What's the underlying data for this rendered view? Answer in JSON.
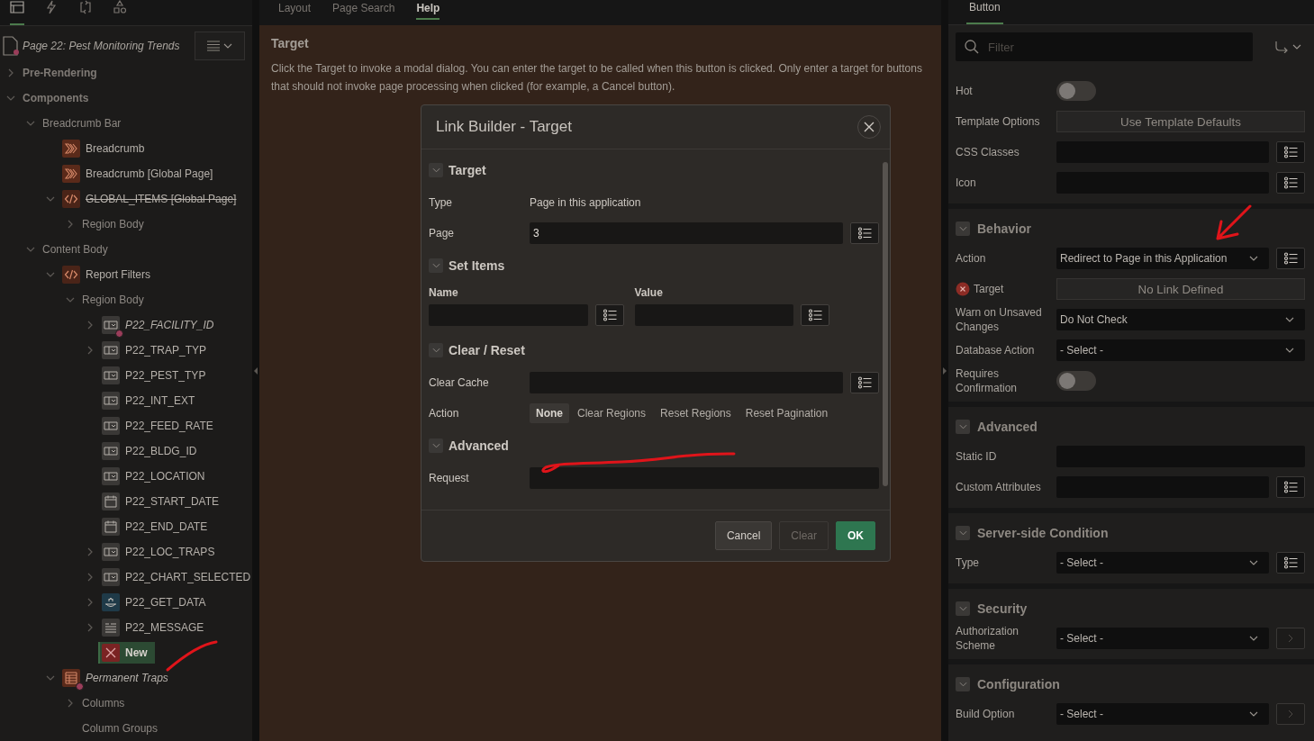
{
  "left_toolbar": {
    "tabs": [
      {
        "kind": "tree",
        "selected": true
      },
      {
        "kind": "bolt",
        "selected": false
      },
      {
        "kind": "loop",
        "selected": false
      },
      {
        "kind": "shapes",
        "selected": false
      }
    ]
  },
  "tree": {
    "page_title": "Page 22: Pest Monitoring Trends",
    "nodes": [
      {
        "label": "Pre-Rendering",
        "kind": "section",
        "expanded": false,
        "selected": false
      },
      {
        "label": "Components",
        "kind": "section",
        "expanded": true,
        "selected": false,
        "children": [
          {
            "label": "Breadcrumb Bar",
            "kind": "plain",
            "expanded": true,
            "selected": false,
            "children": [
              {
                "label": "Breadcrumb",
                "kind": "breadcrumb",
                "selected": false
              },
              {
                "label": "Breadcrumb [Global Page]",
                "kind": "breadcrumb",
                "selected": false
              },
              {
                "label": "GLOBAL_ITEMS [Global Page]",
                "kind": "code",
                "struck": true,
                "expanded": true,
                "selected": false,
                "children": [
                  {
                    "label": "Region Body",
                    "kind": "plain",
                    "expanded": false,
                    "selected": false
                  }
                ]
              }
            ]
          },
          {
            "label": "Content Body",
            "kind": "plain",
            "expanded": true,
            "selected": false,
            "children": [
              {
                "label": "Report Filters",
                "kind": "code",
                "expanded": true,
                "selected": false,
                "children": [
                  {
                    "label": "Region Body",
                    "kind": "plain",
                    "expanded": true,
                    "selected": false,
                    "children": [
                      {
                        "label": "P22_FACILITY_ID",
                        "kind": "select",
                        "italic": true,
                        "badge": true,
                        "expanded": false,
                        "selected": false
                      },
                      {
                        "label": "P22_TRAP_TYP",
                        "kind": "select",
                        "expanded": false,
                        "selected": false
                      },
                      {
                        "label": "P22_PEST_TYP",
                        "kind": "select",
                        "selected": false
                      },
                      {
                        "label": "P22_INT_EXT",
                        "kind": "select",
                        "selected": false
                      },
                      {
                        "label": "P22_FEED_RATE",
                        "kind": "select",
                        "selected": false
                      },
                      {
                        "label": "P22_BLDG_ID",
                        "kind": "select",
                        "selected": false
                      },
                      {
                        "label": "P22_LOCATION",
                        "kind": "select",
                        "selected": false
                      },
                      {
                        "label": "P22_START_DATE",
                        "kind": "date",
                        "selected": false
                      },
                      {
                        "label": "P22_END_DATE",
                        "kind": "date",
                        "selected": false
                      },
                      {
                        "label": "P22_LOC_TRAPS",
                        "kind": "select",
                        "expanded": false,
                        "selected": false
                      },
                      {
                        "label": "P22_CHART_SELECTED",
                        "kind": "select",
                        "expanded": false,
                        "selected": false
                      },
                      {
                        "label": "P22_GET_DATA",
                        "kind": "process",
                        "expanded": false,
                        "selected": false
                      },
                      {
                        "label": "P22_MESSAGE",
                        "kind": "display",
                        "expanded": false,
                        "selected": false
                      },
                      {
                        "label": "New",
                        "kind": "button-error",
                        "selected": true
                      }
                    ]
                  }
                ]
              },
              {
                "label": "Permanent Traps",
                "kind": "report",
                "italic": true,
                "badge": true,
                "expanded": true,
                "selected": false,
                "children": [
                  {
                    "label": "Columns",
                    "kind": "plain",
                    "expanded": false,
                    "selected": false
                  },
                  {
                    "label": "Column Groups",
                    "kind": "plain",
                    "selected": false
                  }
                ]
              }
            ]
          }
        ]
      }
    ]
  },
  "center": {
    "tabs": [
      {
        "label": "Layout",
        "selected": false
      },
      {
        "label": "Page Search",
        "selected": false
      },
      {
        "label": "Help",
        "selected": true
      }
    ],
    "help": {
      "title": "Target",
      "text": "Click the Target to invoke a modal dialog. You can enter the target to be called when this button is clicked. Only enter a target for buttons that should not invoke page processing when clicked (for example, a Cancel button)."
    }
  },
  "properties": {
    "tabs": [
      {
        "label": "Button",
        "selected": true
      }
    ],
    "filter": {
      "placeholder": "Filter"
    },
    "groups": [
      {
        "properties": [
          {
            "label": "Hot",
            "kind": "toggle",
            "on": false
          },
          {
            "label": "Template Options",
            "kind": "button",
            "value": "Use Template Defaults"
          },
          {
            "label": "CSS Classes",
            "kind": "text",
            "list_button": true
          },
          {
            "label": "Icon",
            "kind": "text",
            "list_button": true
          }
        ]
      },
      {
        "title": "Behavior",
        "properties": [
          {
            "label": "Action",
            "kind": "select",
            "value": "Redirect to Page in this Application",
            "list_button": true
          },
          {
            "label": "Target",
            "kind": "button",
            "value": "No Link Defined",
            "error": true
          },
          {
            "label": "Warn on Unsaved Changes",
            "kind": "select",
            "value": "Do Not Check"
          },
          {
            "label": "Database Action",
            "kind": "select",
            "value": "- Select -"
          },
          {
            "label": "Requires Confirmation",
            "kind": "toggle",
            "on": false
          }
        ]
      },
      {
        "title": "Advanced",
        "properties": [
          {
            "label": "Static ID",
            "kind": "text"
          },
          {
            "label": "Custom Attributes",
            "kind": "text",
            "list_button": true
          }
        ]
      },
      {
        "title": "Server-side Condition",
        "properties": [
          {
            "label": "Type",
            "kind": "select",
            "value": "- Select -",
            "list_button": true
          }
        ]
      },
      {
        "title": "Security",
        "properties": [
          {
            "label": "Authorization Scheme",
            "kind": "select",
            "value": "- Select -",
            "go_button": true
          }
        ]
      },
      {
        "title": "Configuration",
        "properties": [
          {
            "label": "Build Option",
            "kind": "select",
            "value": "- Select -",
            "go_button": true
          }
        ]
      }
    ]
  },
  "dialog": {
    "title": "Link Builder - Target",
    "sections": [
      {
        "title": "Target",
        "rows": [
          {
            "kind": "static",
            "label": "Type",
            "value": "Page in this application"
          },
          {
            "kind": "field",
            "label": "Page",
            "value": "3",
            "addon": true
          }
        ]
      },
      {
        "title": "Set Items",
        "rows": [
          {
            "kind": "pair",
            "columns": [
              "Name",
              "Value"
            ]
          }
        ]
      },
      {
        "title": "Clear / Reset",
        "rows": [
          {
            "kind": "field",
            "label": "Clear Cache",
            "addon": true
          },
          {
            "kind": "radio",
            "label": "Action",
            "options": [
              {
                "label": "None",
                "selected": true
              },
              {
                "label": "Clear Regions",
                "selected": false
              },
              {
                "label": "Reset Regions",
                "selected": false
              },
              {
                "label": "Reset Pagination",
                "selected": false
              }
            ]
          }
        ]
      },
      {
        "title": "Advanced",
        "rows": [
          {
            "kind": "field",
            "label": "Request",
            "addon": false
          }
        ]
      }
    ],
    "buttons": [
      {
        "label": "Cancel",
        "kind": "default",
        "disabled": false
      },
      {
        "label": "Clear",
        "kind": "default",
        "disabled": true
      },
      {
        "label": "OK",
        "kind": "primary",
        "disabled": false
      }
    ]
  }
}
